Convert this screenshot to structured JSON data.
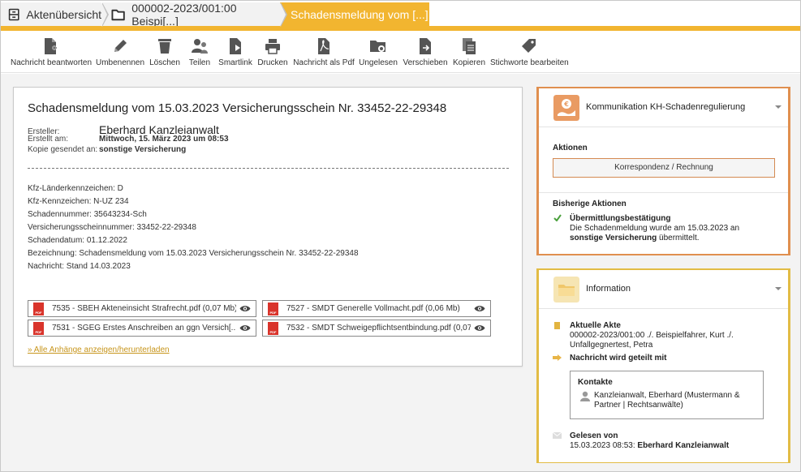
{
  "breadcrumb": {
    "items": [
      {
        "label": "Aktenübersicht",
        "icon": "cabinet-icon"
      },
      {
        "label": "000002-2023/001:00 Beispi[...]",
        "icon": "folder-icon"
      },
      {
        "label": "Schadensmeldung vom [...]"
      }
    ],
    "accent_color": "#f2b530"
  },
  "toolbar": {
    "buttons": [
      {
        "label": "Nachricht beantworten",
        "icon": "reply-doc-icon"
      },
      {
        "label": "Umbenennen",
        "icon": "pencil-icon"
      },
      {
        "label": "Löschen",
        "icon": "trash-icon"
      },
      {
        "label": "Teilen",
        "icon": "share-users-icon"
      },
      {
        "label": "Smartlink",
        "icon": "smartlink-doc-icon"
      },
      {
        "label": "Drucken",
        "icon": "printer-icon"
      },
      {
        "label": "Nachricht als Pdf",
        "icon": "pdf-icon"
      },
      {
        "label": "Ungelesen",
        "icon": "folder-gear-icon"
      },
      {
        "label": "Verschieben",
        "icon": "move-doc-icon"
      },
      {
        "label": "Kopieren",
        "icon": "copy-doc-icon"
      },
      {
        "label": "Stichworte bearbeiten",
        "icon": "tag-icon"
      }
    ]
  },
  "message": {
    "title": "Schadensmeldung vom 15.03.2023 Versicherungsschein Nr. 33452-22-29348",
    "creator_label": "Ersteller:",
    "creator": "Eberhard Kanzleianwalt",
    "created_label": "Erstellt am:",
    "created": "Mittwoch, 15. März 2023 um 08:53",
    "cc_label": "Kopie gesendet an:",
    "cc": "sonstige Versicherung",
    "body_lines": [
      "Kfz-Länderkennzeichen: D",
      "Kfz-Kennzeichen: N-UZ 234",
      "Schadennummer: 35643234-Sch",
      "Versicherungsscheinnummer: 33452-22-29348",
      "Schadendatum: 01.12.2022",
      "Bezeichnung: Schadensmeldung vom 15.03.2023 Versicherungsschein Nr. 33452-22-29348",
      "Nachricht: Stand 14.03.2023"
    ],
    "attachments": [
      "7535 - SBEH Akteneinsicht Strafrecht.pdf (0,07 Mb)",
      "7527 - SMDT Generelle Vollmacht.pdf (0,06 Mb)",
      "7531 - SGEG Erstes Anschreiben an ggn Versich[...]",
      "7532 - SMDT Schweigepflichtsentbindung.pdf (0,07 I"
    ],
    "all_attachments_link": "» Alle Anhänge anzeigen/herunterladen"
  },
  "panel_kommunikation": {
    "title": "Kommunikation KH-Schadenregulierung",
    "icon": "money-hand-icon",
    "accent_color": "#e08f4f",
    "actions_heading": "Aktionen",
    "action_button": "Korrespondenz / Rechnung",
    "previous_heading": "Bisherige Aktionen",
    "previous_title": "Übermittlungsbestätigung",
    "previous_text_1": "Die Schadenmeldung wurde am 15.03.2023 an",
    "previous_text_bold": "sonstige Versicherung",
    "previous_text_2": " übermittelt."
  },
  "panel_information": {
    "title": "Information",
    "icon": "folder-open-icon",
    "accent_color": "#e2bc45",
    "akte_heading": "Aktuelle Akte",
    "akte_line_1": "000002-2023/001:00 ./. Beispielfahrer, Kurt ./.",
    "akte_line_2": "Unfallgegnertest, Petra",
    "shared_heading": "Nachricht wird geteilt mit",
    "kontakte_heading": "Kontakte",
    "kontakt_line_1": "Kanzleianwalt, Eberhard (Mustermann &",
    "kontakt_line_2": "Partner | Rechtsanwälte)",
    "gelesen_heading": "Gelesen von",
    "gelesen_date": "15.03.2023 08:53:",
    "gelesen_name": "Eberhard Kanzleianwalt"
  }
}
